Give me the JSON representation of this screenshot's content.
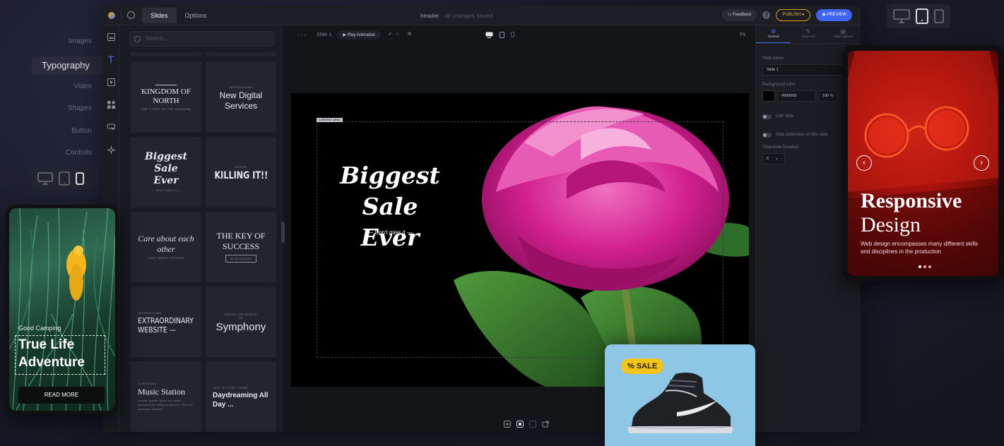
{
  "categories": [
    "Images",
    "Typography",
    "Video",
    "Shapes",
    "Button",
    "Controls"
  ],
  "topbar": {
    "tabs": [
      "Slides",
      "Options"
    ],
    "title": "header",
    "title_note": "· all changes saved",
    "feedback": "Feedback",
    "help": "?",
    "publish": "PUBLISH",
    "preview": "PREVIEW"
  },
  "templates": {
    "search_placeholder": "Search...",
    "cards": [
      {
        "main": "KINGDOM OF NORTH",
        "small": "THE STORY OF THE KINGDOM"
      },
      {
        "pre": "INTRODUCING",
        "main": "New Digital Services"
      },
      {
        "main": "Biggest Sale Ever",
        "small": "— Don't miss it —"
      },
      {
        "pre": "YOU'RE",
        "main": "KILLING IT!!"
      },
      {
        "main": "Care about each other",
        "small": "TAKE ABOUT OTHERS"
      },
      {
        "main": "THE KEY OF SUCCESS",
        "small": "IN BUSINESS"
      },
      {
        "pre": "INTRODUCING",
        "main": "EXTRAORDINARY WEBSITE —"
      },
      {
        "pre": "ENTER THE WORLD OF",
        "main": "Symphony"
      },
      {
        "pre": "CLASSICAL",
        "main": "Music Station",
        "small": "Lorem ipsum dolor sit amet, consectetur adipiscing elit. Sed do eiusmod tempor"
      },
      {
        "pre": "JUST SITTING THERE",
        "main": "Daydreaming All Day ..."
      }
    ]
  },
  "canvas": {
    "slide_name": "Slide 1",
    "play": "Play Animation",
    "zoom": "Fit",
    "content_tag": "CONTENT AREA",
    "headline_1": "Biggest",
    "headline_2": "Sale Ever",
    "subline": "— Don't miss it —"
  },
  "settings": {
    "tabs": [
      "General",
      "Advanced",
      "Slide Options"
    ],
    "slide_name_label": "Slide name",
    "slide_name_value": "Slide 1",
    "bg_color_label": "Background color",
    "bg_color_value": "#000000",
    "bg_opacity": "100 %",
    "link_slide": "Link slide",
    "stop_slideshow": "Stop slideshow on this slide",
    "duration_label": "Slideshow Duration",
    "duration_value": "5"
  },
  "phone": {
    "pre": "Good Camping",
    "title_1": "True Life",
    "title_2": "Adventure",
    "button": "READ MORE"
  },
  "tablet": {
    "title_1": "Responsive",
    "title_2": "Design",
    "body": "Web design encompasses many different skills and disciplines in the production"
  },
  "sale": {
    "badge": "% SALE"
  },
  "colors": {
    "accent": "#4b6cf7",
    "publish": "#e6b33a",
    "sale_bg": "#8ec6e6",
    "sale_badge": "#f3c419"
  }
}
